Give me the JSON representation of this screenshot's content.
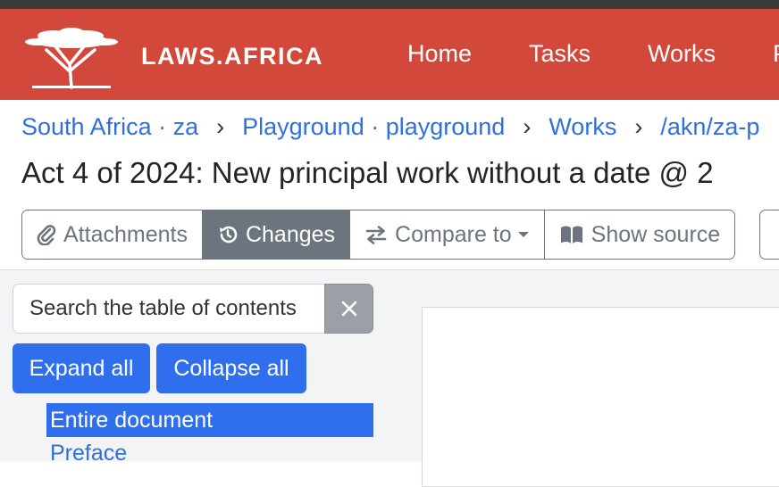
{
  "header": {
    "brand": "LAWS.AFRICA",
    "nav": [
      {
        "label": "Home"
      },
      {
        "label": "Tasks"
      },
      {
        "label": "Works"
      },
      {
        "label": "P"
      }
    ]
  },
  "breadcrumb": [
    "South Africa · za",
    "Playground · playground",
    "Works",
    "/akn/za-p"
  ],
  "breadcrumb_separator": "›",
  "page_title": "Act 4 of 2024: New principal work without a date @ 2",
  "toolbar": {
    "attachments": "Attachments",
    "changes": "Changes",
    "compare_to": "Compare to",
    "show_source": "Show source"
  },
  "toc": {
    "search_placeholder": "Search the table of contents",
    "expand_all": "Expand all",
    "collapse_all": "Collapse all",
    "items": [
      "Entire document",
      "Preface"
    ]
  },
  "colors": {
    "brand_red": "#d2483a",
    "link_blue": "#2f6fe0",
    "primary_blue": "#2f6fed",
    "secondary_gray": "#6c757d"
  },
  "icons": {
    "attachments": "paperclip-icon",
    "changes": "history-icon",
    "compare_to": "exchange-arrows-icon",
    "show_source": "book-icon",
    "clear": "close-icon"
  }
}
